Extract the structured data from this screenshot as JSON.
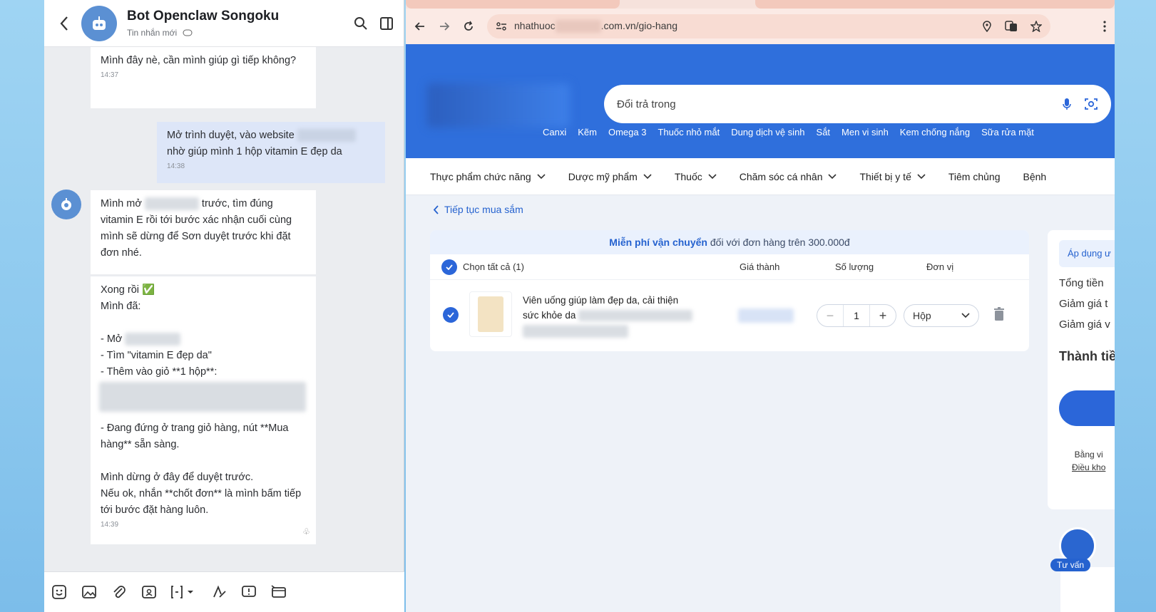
{
  "chat": {
    "title": "Bot Openclaw Songoku",
    "subtitle": "Tin nhắn mới",
    "messages": [
      {
        "text": "Mình đây nè, cần mình giúp gì tiếp không?",
        "time": "14:37"
      },
      {
        "text_before": "Mở trình duyệt, vào website",
        "text_after": "nhờ giúp mình 1 hộp vitamin E đẹp da",
        "time": "14:38"
      },
      {
        "text_before": "Mình mở",
        "text_after": "trước, tìm đúng vitamin E rồi tới bước xác nhận cuối cùng mình sẽ dừng để Sơn duyệt trước khi đặt đơn nhé."
      },
      {
        "done_line": "Xong rồi",
        "done_emoji": "✅",
        "intro": "Mình đã:",
        "step1": "- Mở",
        "step2": "- Tìm \"vitamin E đẹp da\"",
        "step3": "- Thêm vào giỏ **1 hộp**:",
        "step4": "- Đang đứng ở trang giỏ hàng, nút **Mua hàng** sẵn sàng.",
        "wait1": "Mình dừng ở đây để duyệt trước.",
        "wait2": "Nếu ok, nhắn **chốt đơn** là mình bấm tiếp tới bước đặt hàng luôn.",
        "time": "14:39"
      }
    ]
  },
  "browser": {
    "url_start": "nhathuoc",
    "url_end": ".com.vn/gio-hang",
    "search_value": "Đổi trả trong",
    "quick_links": [
      "Canxi",
      "Kẽm",
      "Omega 3",
      "Thuốc nhỏ mắt",
      "Dung dịch vệ sinh",
      "Sắt",
      "Men vi sinh",
      "Kem chống nắng",
      "Sữa rửa mặt"
    ],
    "categories": [
      "Thực phẩm chức năng",
      "Dược mỹ phẩm",
      "Thuốc",
      "Chăm sóc cá nhân",
      "Thiết bị y tế",
      "Tiêm chủng",
      "Bệnh"
    ],
    "continue_label": "Tiếp tục mua sắm",
    "ship_banner_bold": "Miễn phí vận chuyển",
    "ship_banner_rest": "đối với đơn hàng trên 300.000đ",
    "select_all": "Chọn tất cả (1)",
    "col_price": "Giá thành",
    "col_qty": "Số lượng",
    "col_unit": "Đơn vị",
    "product_line1": "Viên uống giúp làm đẹp da, cải thiện",
    "product_line2": "sức khỏe da",
    "quantity": "1",
    "unit": "Hộp",
    "summary": {
      "apply": "Áp dụng ư",
      "total": "Tổng tiền",
      "discount1": "Giảm giá t",
      "discount2": "Giảm giá v",
      "final": "Thành tiề",
      "terms1": "Bằng vi",
      "terms2": "Điều kho"
    },
    "consult_label": "Tư vấn",
    "colors": {
      "brand": "#2f6fdc",
      "accent": "#2562cf",
      "chat_bg": "#ebedf0"
    }
  }
}
